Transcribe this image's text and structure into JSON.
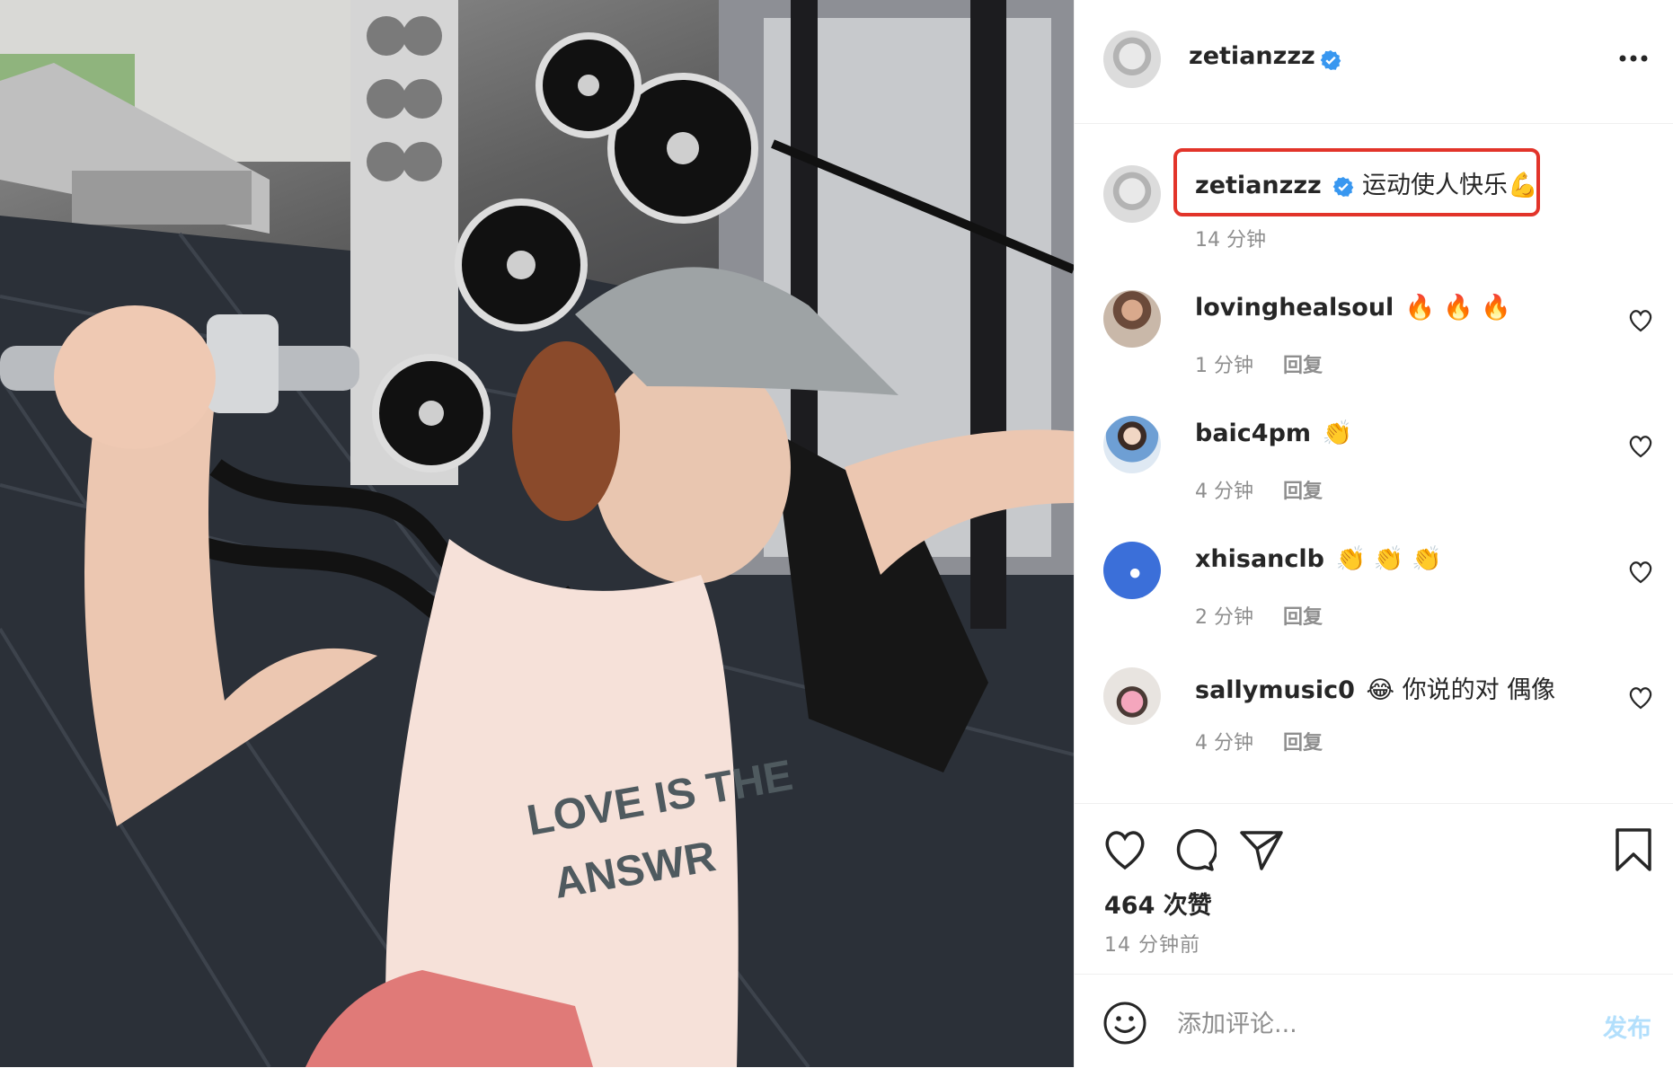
{
  "post": {
    "image_alt": "",
    "author": {
      "username": "zetianzzz",
      "verified": true
    },
    "caption": {
      "text": "运动使人快乐💪",
      "time": "14 分钟"
    },
    "comments": [
      {
        "username": "lovinghealsoul",
        "text": "🔥 🔥 🔥",
        "time": "1 分钟",
        "reply": "回复"
      },
      {
        "username": "baic4pm",
        "text": "👏",
        "time": "4 分钟",
        "reply": "回复"
      },
      {
        "username": "xhisanclb",
        "text": "👏 👏 👏",
        "time": "2 分钟",
        "reply": "回复"
      },
      {
        "username": "sallymusic0",
        "text": "😂 你说的对 偶像",
        "time": "4 分钟",
        "reply": "回复"
      }
    ],
    "likes": "464 次赞",
    "posted": "14 分钟前",
    "comment_input": {
      "placeholder": "添加评论...",
      "submit": "发布"
    }
  },
  "colors": {
    "verified": "#3897f0",
    "highlight": "#e2342a",
    "post_button": "#b2dffc",
    "muted_text": "#8e8e8e"
  }
}
